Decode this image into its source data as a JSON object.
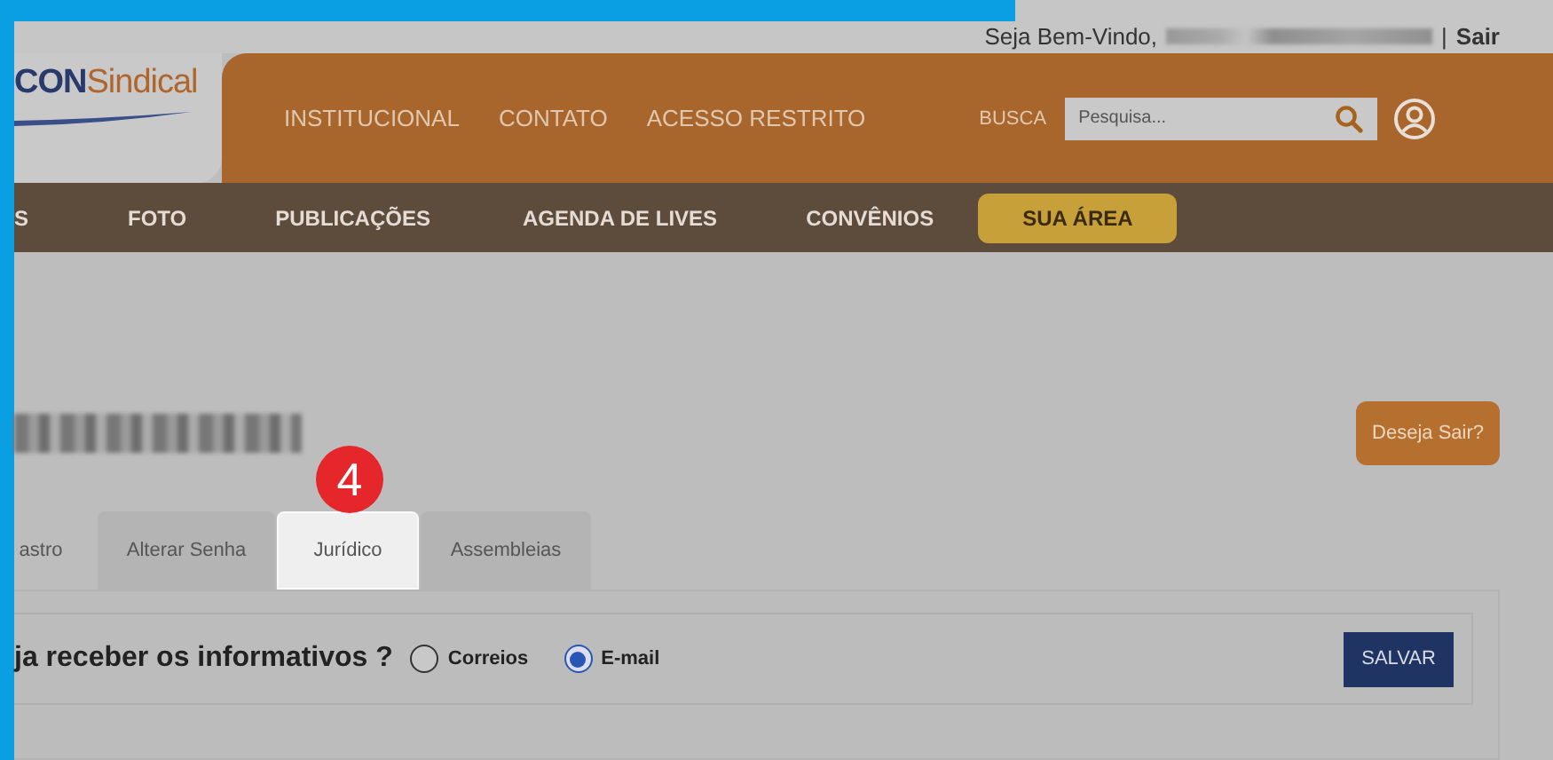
{
  "top_bar": {
    "greeting": "Seja Bem-Vindo,",
    "separator": "|",
    "logout": "Sair"
  },
  "logo": {
    "bold": "CON",
    "text": "Sindical"
  },
  "main_nav": [
    "INSTITUCIONAL",
    "CONTATO",
    "ACESSO RESTRITO"
  ],
  "search": {
    "label": "BUSCA",
    "placeholder": "Pesquisa..."
  },
  "sub_nav": [
    {
      "label": "S",
      "kind": "link"
    },
    {
      "label": "FOTO",
      "kind": "link"
    },
    {
      "label": "PUBLICAÇÕES",
      "kind": "link"
    },
    {
      "label": "AGENDA DE LIVES",
      "kind": "link"
    },
    {
      "label": "CONVÊNIOS",
      "kind": "link"
    },
    {
      "label": "SUA ÁREA",
      "kind": "pill"
    }
  ],
  "logout_button": "Deseja Sair?",
  "step_badge": "4",
  "tabs": [
    {
      "label": "astro",
      "selected": false
    },
    {
      "label": "Alterar Senha",
      "selected": false
    },
    {
      "label": "Jurídico",
      "selected": true
    },
    {
      "label": "Assembleias",
      "selected": false
    }
  ],
  "question": "ja receber os informativos ?",
  "options": [
    {
      "label": "Correios",
      "selected": false
    },
    {
      "label": "E-mail",
      "selected": true
    }
  ],
  "save_button": "SALVAR"
}
